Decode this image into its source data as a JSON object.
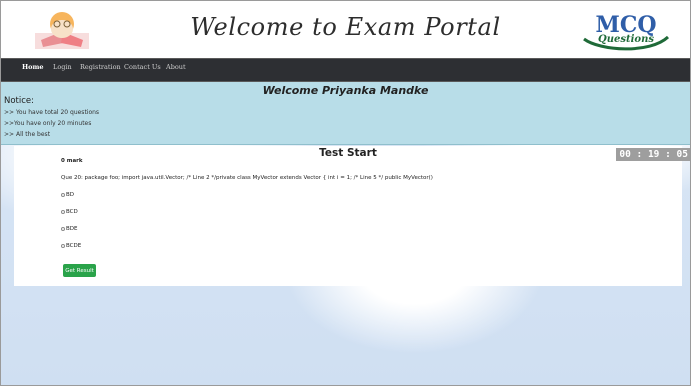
{
  "header": {
    "title": "Welcome to Exam Portal",
    "logo_right_text": [
      "MCQ",
      "Questions"
    ],
    "colors": {
      "title": "#2d2d2d",
      "logo_blue": "#2f5ea8",
      "logo_green": "#1f6a38"
    }
  },
  "nav": {
    "items": [
      "Home",
      "Login",
      "Registration",
      "Contact Us",
      "About"
    ]
  },
  "notice": {
    "welcome": "Welcome Priyanka Mandke",
    "title": "Notice:",
    "lines": [
      ">> You have total 20 questions",
      ">>You have only 20 minutes",
      ">> All the best"
    ]
  },
  "test": {
    "title": "Test Start",
    "timer": "00 : 19 : 05",
    "marks": "0 mark",
    "question": "Que 20: package foo; import java.util.Vector; /* Line 2 */private class MyVector extends Vector { int i = 1; /* Line 5 */ public MyVector()",
    "options": [
      "BD",
      "BCD",
      "BDE",
      "BCDE"
    ],
    "button": "Get Result",
    "colors": {
      "button": "#2aa34a",
      "timer_bg": "#9e9e9e"
    }
  }
}
